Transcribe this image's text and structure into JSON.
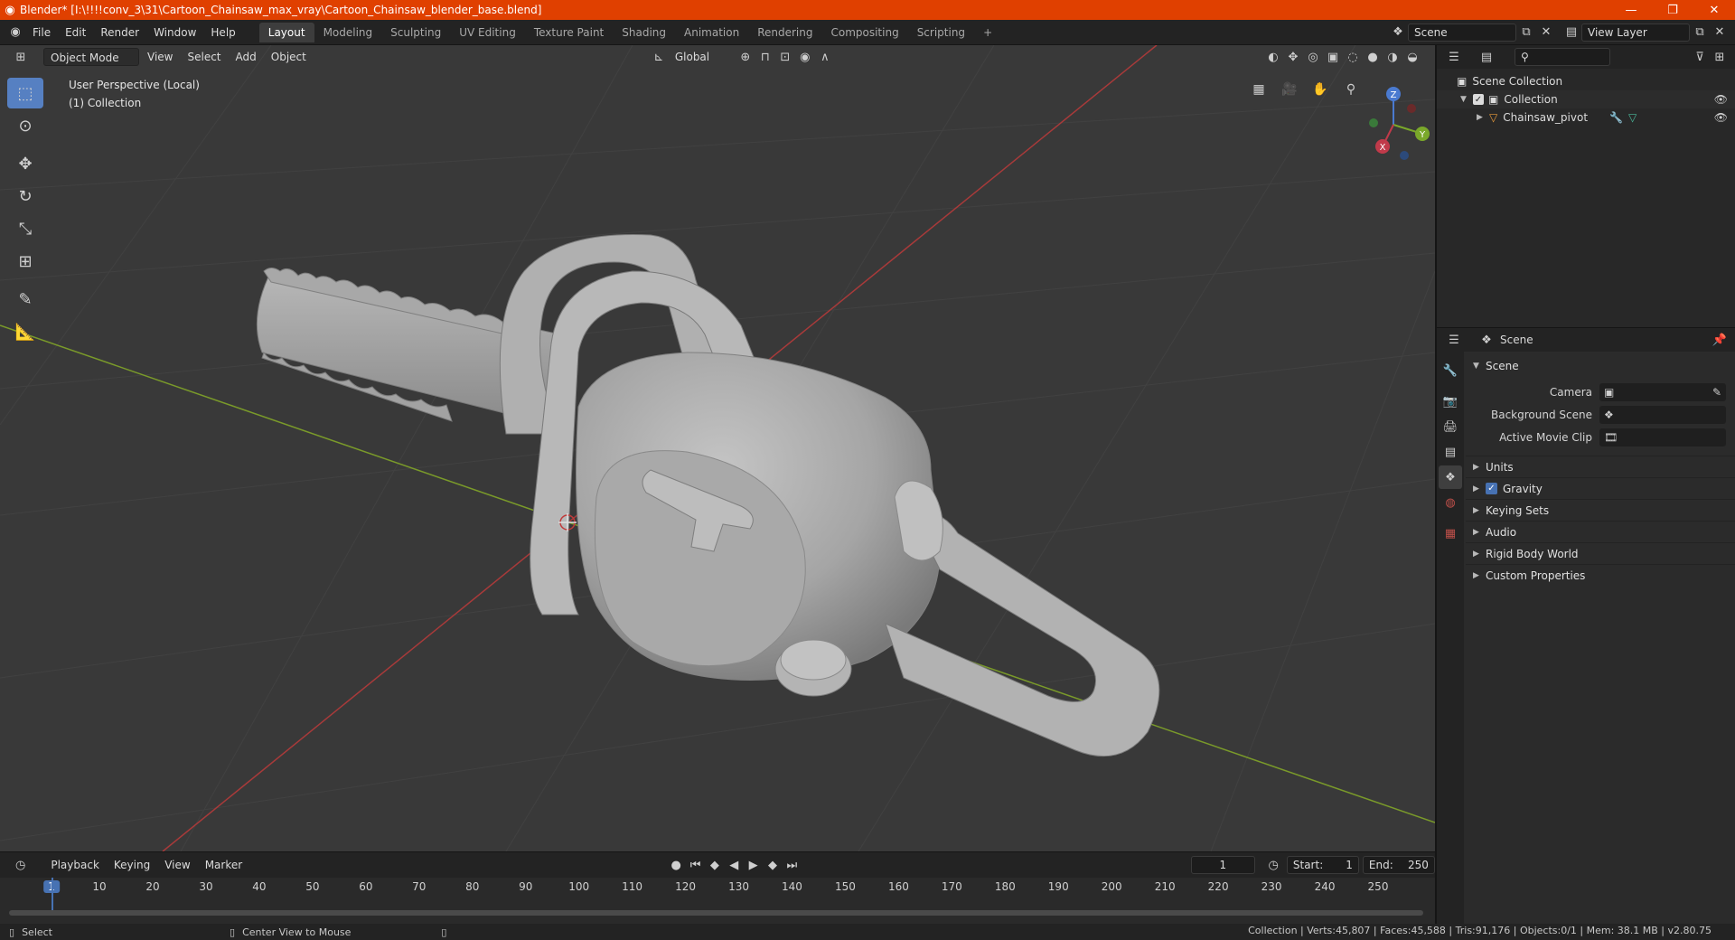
{
  "window": {
    "title": "Blender* [I:\\!!!!conv_3\\31\\Cartoon_Chainsaw_max_vray\\Cartoon_Chainsaw_blender_base.blend]",
    "minimize": "—",
    "maximize": "❐",
    "close": "✕"
  },
  "menu": {
    "file": "File",
    "edit": "Edit",
    "render": "Render",
    "window": "Window",
    "help": "Help"
  },
  "workspaces": [
    "Layout",
    "Modeling",
    "Sculpting",
    "UV Editing",
    "Texture Paint",
    "Shading",
    "Animation",
    "Rendering",
    "Compositing",
    "Scripting"
  ],
  "add_workspace": "+",
  "scene_selector": {
    "value": "Scene"
  },
  "view_layer_selector": {
    "value": "View Layer"
  },
  "viewport_header": {
    "mode": "Object Mode",
    "view": "View",
    "select": "Select",
    "add": "Add",
    "object": "Object",
    "orientation": "Global"
  },
  "viewport_info": {
    "line1": "User Perspective (Local)",
    "line2": "(1) Collection"
  },
  "gizmo": {
    "z": "Z",
    "y": "Y",
    "x": "X"
  },
  "outliner": {
    "scene_collection": "Scene Collection",
    "collection": "Collection",
    "object": "Chainsaw_pivot"
  },
  "properties": {
    "header": "Scene",
    "panel": "Scene",
    "camera_label": "Camera",
    "background_scene_label": "Background Scene",
    "active_movie_clip_label": "Active Movie Clip",
    "subpanels": [
      "Units",
      "Gravity",
      "Keying Sets",
      "Audio",
      "Rigid Body World",
      "Custom Properties"
    ]
  },
  "timeline": {
    "playback": "Playback",
    "keying": "Keying",
    "view": "View",
    "marker": "Marker",
    "current_frame": "1",
    "start_label": "Start:",
    "start_value": "1",
    "end_label": "End:",
    "end_value": "250",
    "ticks": [
      "1",
      "10",
      "20",
      "30",
      "40",
      "50",
      "60",
      "70",
      "80",
      "90",
      "100",
      "110",
      "120",
      "130",
      "140",
      "150",
      "160",
      "170",
      "180",
      "190",
      "200",
      "210",
      "220",
      "230",
      "240",
      "250"
    ]
  },
  "statusbar": {
    "select": "Select",
    "center_view": "Center View to Mouse",
    "stats": "Collection | Verts:45,807 | Faces:45,588 | Tris:91,176 | Objects:0/1 | Mem: 38.1 MB | v2.80.75"
  },
  "colors": {
    "title_bar": "#e04000",
    "accent_blue": "#4772b3",
    "viewport_bg": "#393939",
    "x_axis": "#a83a3a",
    "y_axis": "#7a9a2a"
  }
}
